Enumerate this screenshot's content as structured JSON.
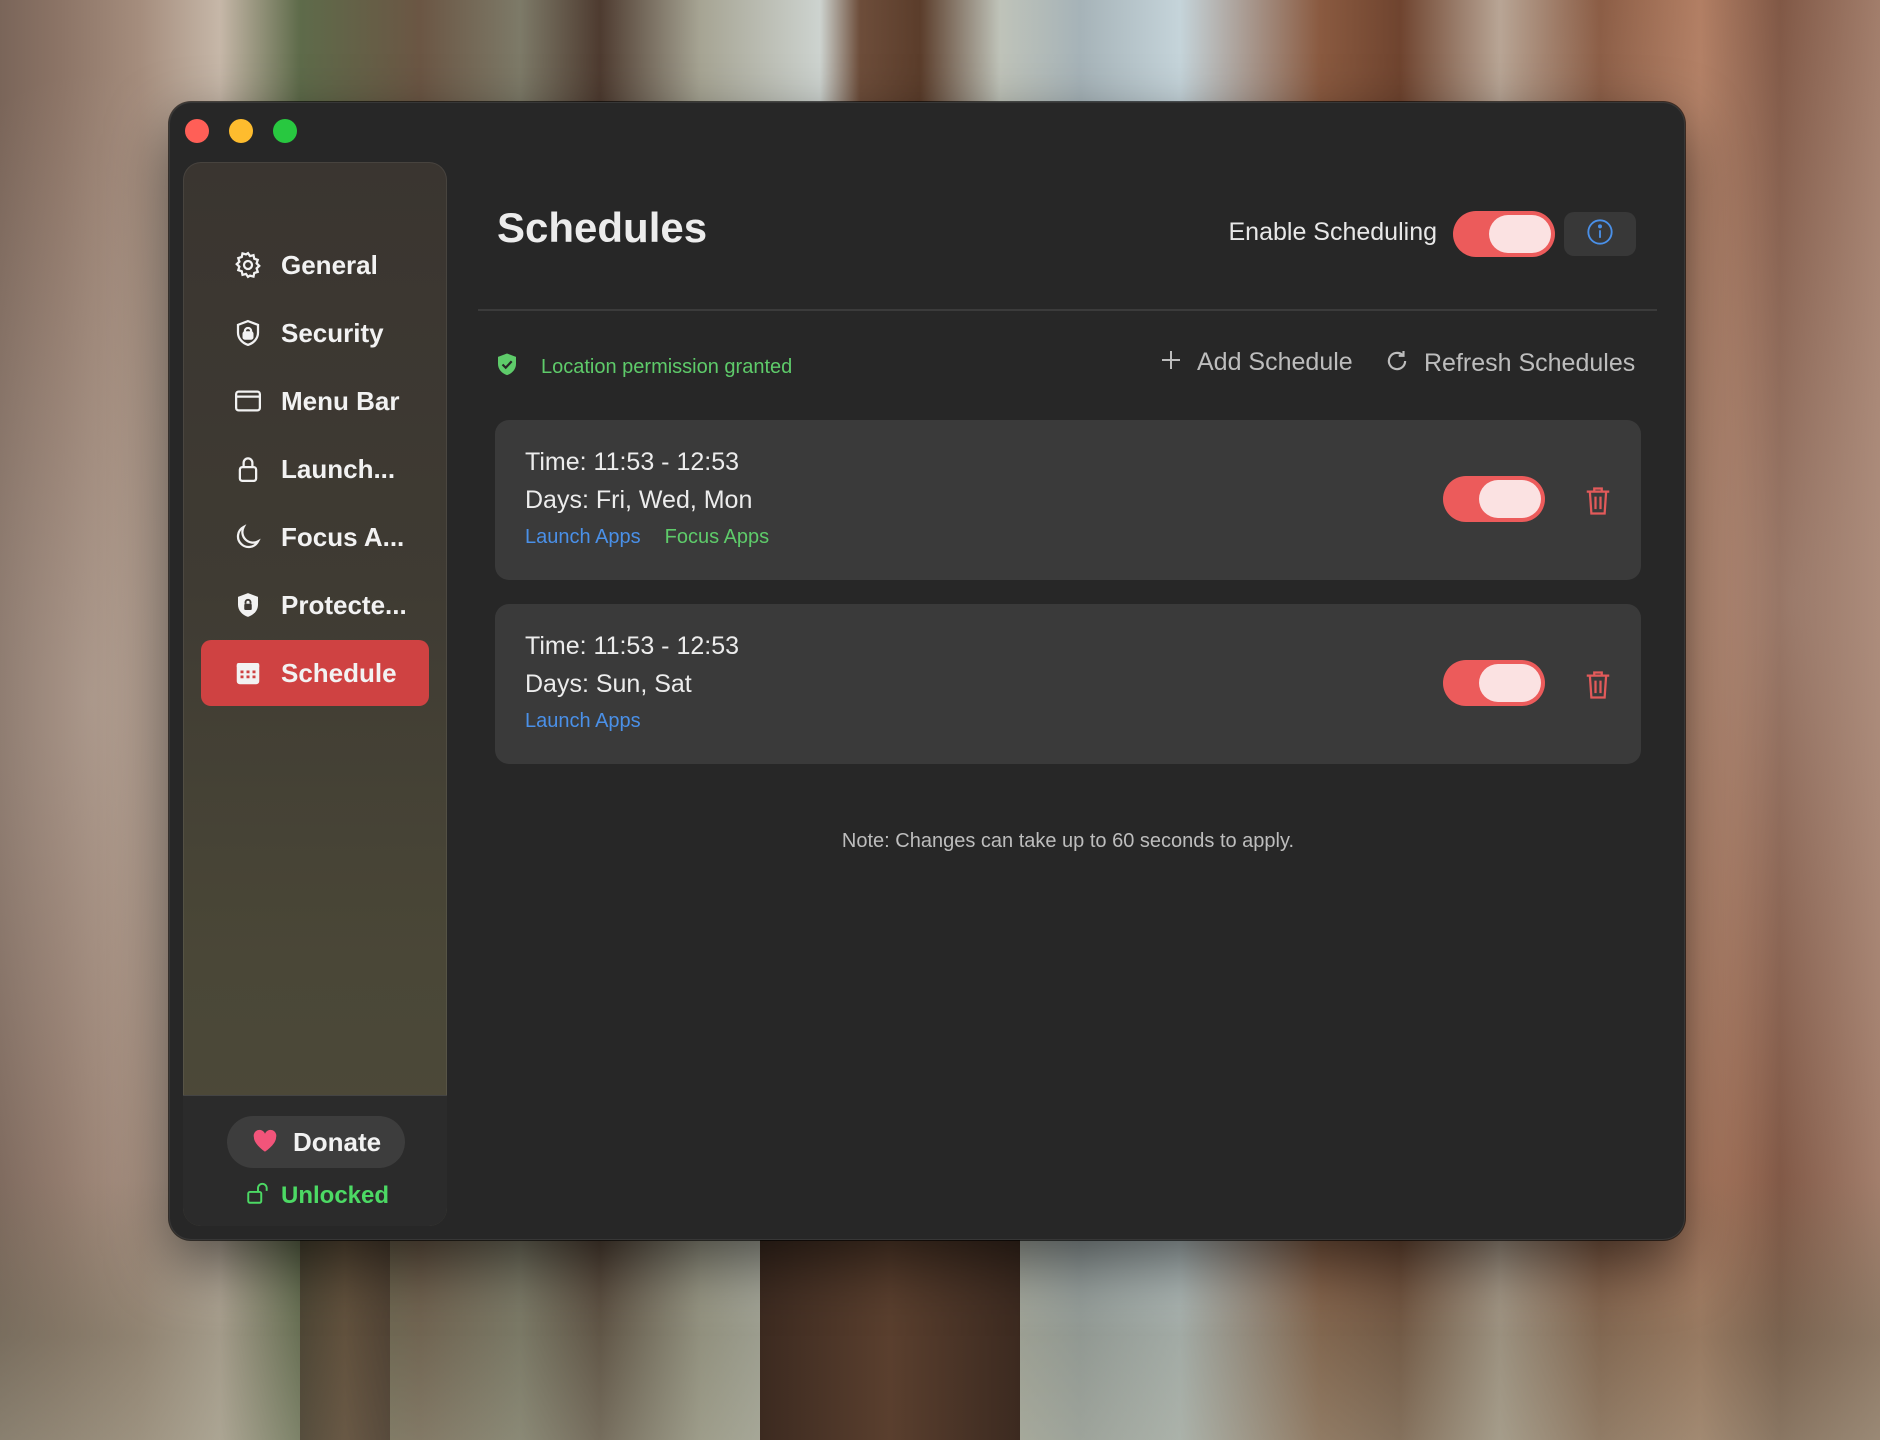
{
  "window": {
    "traffic_lights": [
      "close",
      "minimize",
      "zoom"
    ]
  },
  "sidebar": {
    "items": [
      {
        "label": "General",
        "icon": "gear-icon",
        "active": false
      },
      {
        "label": "Security",
        "icon": "shield-icon",
        "active": false
      },
      {
        "label": "Menu Bar",
        "icon": "menubar-window-icon",
        "active": false
      },
      {
        "label": "Launch...",
        "icon": "lock-icon",
        "active": false
      },
      {
        "label": "Focus A...",
        "icon": "moon-icon",
        "active": false
      },
      {
        "label": "Protecte...",
        "icon": "shield-lock-icon",
        "active": false
      },
      {
        "label": "Schedule",
        "icon": "calendar-icon",
        "active": true
      }
    ],
    "donate_label": "Donate",
    "status_label": "Unlocked"
  },
  "header": {
    "title": "Schedules",
    "enable_label": "Enable Scheduling",
    "enable_on": true
  },
  "toolbar": {
    "permission_text": "Location permission granted",
    "add_label": "Add Schedule",
    "refresh_label": "Refresh Schedules"
  },
  "schedules": [
    {
      "time": "Time: 11:53 - 12:53",
      "days": "Days: Fri, Wed, Mon",
      "tags": [
        "Launch Apps",
        "Focus Apps"
      ],
      "enabled": true
    },
    {
      "time": "Time: 11:53 - 12:53",
      "days": "Days: Sun, Sat",
      "tags": [
        "Launch Apps"
      ],
      "enabled": true
    }
  ],
  "note": "Note: Changes can take up to 60 seconds to apply.",
  "colors": {
    "accent": "#cf4242",
    "toggle_on": "#ec5b5b",
    "success": "#5ecb6a",
    "link": "#4a90e8"
  }
}
